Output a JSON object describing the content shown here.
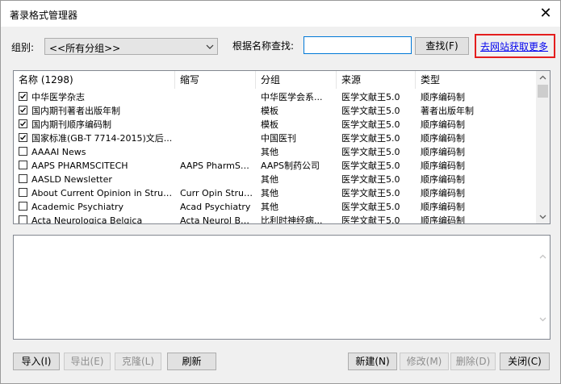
{
  "window": {
    "title": "著录格式管理器",
    "close_label": "✕"
  },
  "filter": {
    "group_label": "组别:",
    "group_value": "<<所有分组>>",
    "search_label": "根据名称查找:",
    "search_value": "",
    "find_button": "查找(F)",
    "more_link": "去网站获取更多"
  },
  "table": {
    "headers": [
      "名称 (1298)",
      "缩写",
      "分组",
      "来源",
      "类型"
    ],
    "rows": [
      {
        "checked": true,
        "name": "中华医学杂志",
        "abbr": "",
        "group": "中华医学会系...",
        "source": "医学文献王5.0",
        "type": "顺序编码制"
      },
      {
        "checked": true,
        "name": "国内期刊著者出版年制",
        "abbr": "",
        "group": "模板",
        "source": "医学文献王5.0",
        "type": "著者出版年制"
      },
      {
        "checked": true,
        "name": "国内期刊顺序编码制",
        "abbr": "",
        "group": "模板",
        "source": "医学文献王5.0",
        "type": "顺序编码制"
      },
      {
        "checked": true,
        "name": "国家标准(GB-T 7714-2015)文后...",
        "abbr": "",
        "group": "中国医刊",
        "source": "医学文献王5.0",
        "type": "顺序编码制"
      },
      {
        "checked": false,
        "name": "AAAAI News",
        "abbr": "",
        "group": "其他",
        "source": "医学文献王5.0",
        "type": "顺序编码制"
      },
      {
        "checked": false,
        "name": "AAPS PHARMSCITECH",
        "abbr": "AAPS PharmSci...",
        "group": "AAPS制药公司",
        "source": "医学文献王5.0",
        "type": "顺序编码制"
      },
      {
        "checked": false,
        "name": "AASLD Newsletter",
        "abbr": "",
        "group": "其他",
        "source": "医学文献王5.0",
        "type": "顺序编码制"
      },
      {
        "checked": false,
        "name": "About Current Opinion in Structur...",
        "abbr": "Curr Opin Struc...",
        "group": "其他",
        "source": "医学文献王5.0",
        "type": "顺序编码制"
      },
      {
        "checked": false,
        "name": "Academic Psychiatry",
        "abbr": "Acad Psychiatry",
        "group": "其他",
        "source": "医学文献王5.0",
        "type": "顺序编码制"
      },
      {
        "checked": false,
        "name": "Acta Neurologica Belgica",
        "abbr": "Acta Neurol Belg",
        "group": "比利时神经病...",
        "source": "医学文献王5.0",
        "type": "顺序编码制"
      }
    ]
  },
  "buttons": {
    "import": "导入(I)",
    "export": "导出(E)",
    "clone": "克隆(L)",
    "refresh": "刷新",
    "new": "新建(N)",
    "modify": "修改(M)",
    "delete": "删除(D)",
    "close": "关闭(C)"
  }
}
